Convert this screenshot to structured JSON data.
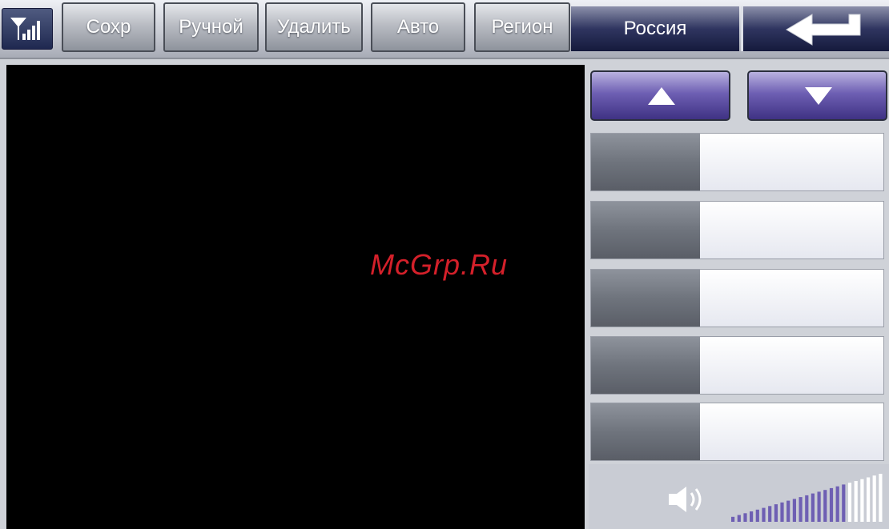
{
  "toolbar": {
    "buttons": [
      {
        "label": "Сохр"
      },
      {
        "label": "Ручной"
      },
      {
        "label": "Удалить"
      },
      {
        "label": "Авто"
      },
      {
        "label": "Регион"
      }
    ],
    "region": "Россия"
  },
  "icons": {
    "signal": "signal-strength-icon",
    "back": "back-arrow-icon",
    "up": "up-arrow-icon",
    "down": "down-arrow-icon",
    "volume": "speaker-icon"
  },
  "presets": [
    {
      "number": "",
      "frequency": ""
    },
    {
      "number": "",
      "frequency": ""
    },
    {
      "number": "",
      "frequency": ""
    },
    {
      "number": "",
      "frequency": ""
    },
    {
      "number": "",
      "frequency": ""
    }
  ],
  "volume": {
    "level": 0.75,
    "bars_total": 25
  },
  "watermark": "McGrp.Ru",
  "colors": {
    "accent": "#6e5fb3",
    "title_bar": "#2f3560",
    "video": "#000000"
  }
}
